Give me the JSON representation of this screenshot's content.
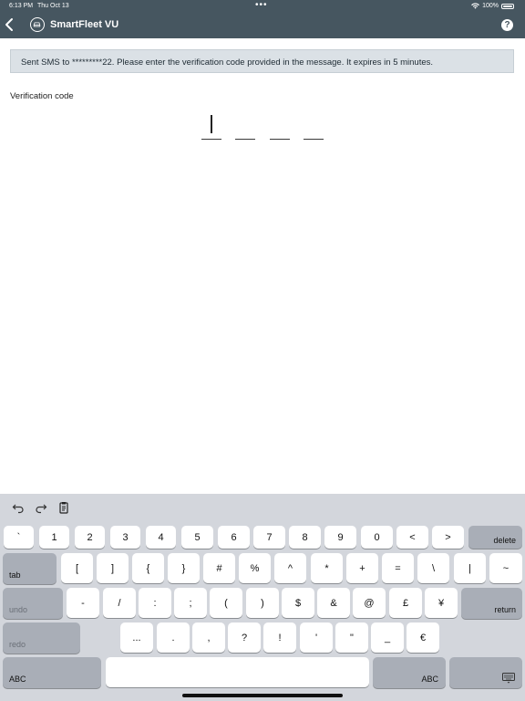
{
  "status_bar": {
    "time": "6:13 PM",
    "date": "Thu Oct 13",
    "battery": "100%"
  },
  "nav": {
    "title": "SmartFleet VU",
    "help_label": "?"
  },
  "message": "Sent SMS to *********22. Please enter the verification code provided in the message. It expires in 5 minutes.",
  "verification": {
    "label": "Verification code",
    "digits": [
      "",
      "",
      "",
      ""
    ]
  },
  "keyboard": {
    "icons": {
      "undo": "undo-icon",
      "redo": "redo-icon",
      "paste": "paste-icon",
      "dismiss": "keyboard-dismiss-icon"
    },
    "row1": [
      "`",
      "1",
      "2",
      "3",
      "4",
      "5",
      "6",
      "7",
      "8",
      "9",
      "0",
      "<",
      ">"
    ],
    "delete_label": "delete",
    "tab_label": "tab",
    "row2": [
      "[",
      "]",
      "{",
      "}",
      "#",
      "%",
      "^",
      "*",
      "+",
      "=",
      "\\",
      "|",
      "~"
    ],
    "undo_label": "undo",
    "row3": [
      "-",
      "/",
      ":",
      ";",
      "(",
      ")",
      "$",
      "&",
      "@",
      "£",
      "¥"
    ],
    "return_label": "return",
    "redo_label": "redo",
    "row4": [
      "...",
      ".",
      ",",
      "?",
      "!",
      "'",
      "\"",
      "_",
      "€"
    ],
    "abc_label": "ABC"
  }
}
